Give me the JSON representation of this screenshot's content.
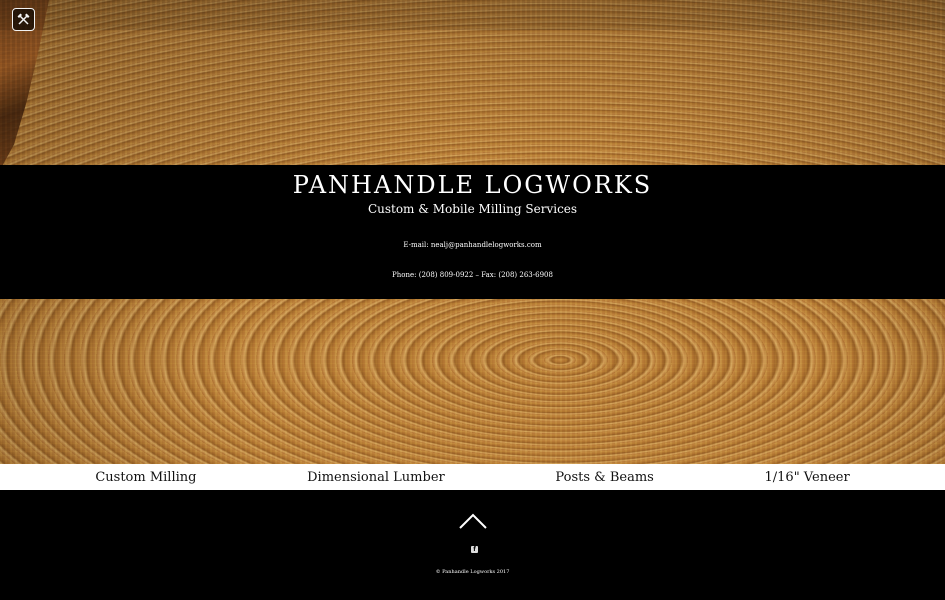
{
  "brand": {
    "title": "PANHANDLE LOGWORKS",
    "subtitle": "Custom & Mobile Milling Services"
  },
  "contact": {
    "email": "E-mail: nealj@panhandlelogworks.com",
    "phone": "Phone: (208) 809-0922 – Fax: (208) 263-6908"
  },
  "nav": {
    "items": [
      {
        "label": "Custom Milling"
      },
      {
        "label": "Dimensional Lumber"
      },
      {
        "label": "Posts & Beams"
      },
      {
        "label": "1/16\" Veneer"
      }
    ]
  },
  "footer": {
    "copyright": "© Panhandle Logworks 2017"
  },
  "icons": {
    "top_left": "tools-icon",
    "back_to_top": "chevron-up-icon",
    "social": "facebook-icon"
  },
  "colors": {
    "band": "#000000",
    "nav_bg": "#ffffff",
    "text_light": "#ffffff",
    "wood": "#b07532"
  }
}
